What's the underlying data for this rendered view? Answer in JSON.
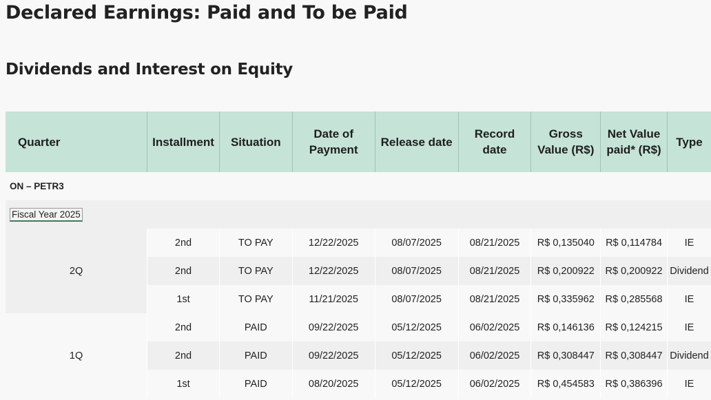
{
  "page_title": "Declared Earnings: Paid and To be Paid",
  "section_title": "Dividends and Interest on Equity",
  "table": {
    "headers": [
      "Quarter",
      "Installment",
      "Situation",
      "Date of Payment",
      "Release date",
      "Record date",
      "Gross Value (R$)",
      "Net Value paid* (R$)",
      "Type"
    ],
    "share_class": "ON – PETR3",
    "fiscal_year": "Fiscal Year 2025",
    "quarters": [
      {
        "label": "2Q",
        "rows": [
          [
            "2nd",
            "TO PAY",
            "12/22/2025",
            "08/07/2025",
            "08/21/2025",
            "R$ 0,135040",
            "R$ 0,114784",
            "IE"
          ],
          [
            "2nd",
            "TO PAY",
            "12/22/2025",
            "08/07/2025",
            "08/21/2025",
            "R$ 0,200922",
            "R$ 0,200922",
            "Dividend"
          ],
          [
            "1st",
            "TO PAY",
            "11/21/2025",
            "08/07/2025",
            "08/21/2025",
            "R$ 0,335962",
            "R$ 0,285568",
            "IE"
          ]
        ]
      },
      {
        "label": "1Q",
        "rows": [
          [
            "2nd",
            "PAID",
            "09/22/2025",
            "05/12/2025",
            "06/02/2025",
            "R$ 0,146136",
            "R$ 0,124215",
            "IE"
          ],
          [
            "2nd",
            "PAID",
            "09/22/2025",
            "05/12/2025",
            "06/02/2025",
            "R$ 0,308447",
            "R$ 0,308447",
            "Dividend"
          ],
          [
            "1st",
            "PAID",
            "08/20/2025",
            "05/12/2025",
            "06/02/2025",
            "R$ 0,454583",
            "R$ 0,386396",
            "IE"
          ]
        ]
      }
    ]
  }
}
